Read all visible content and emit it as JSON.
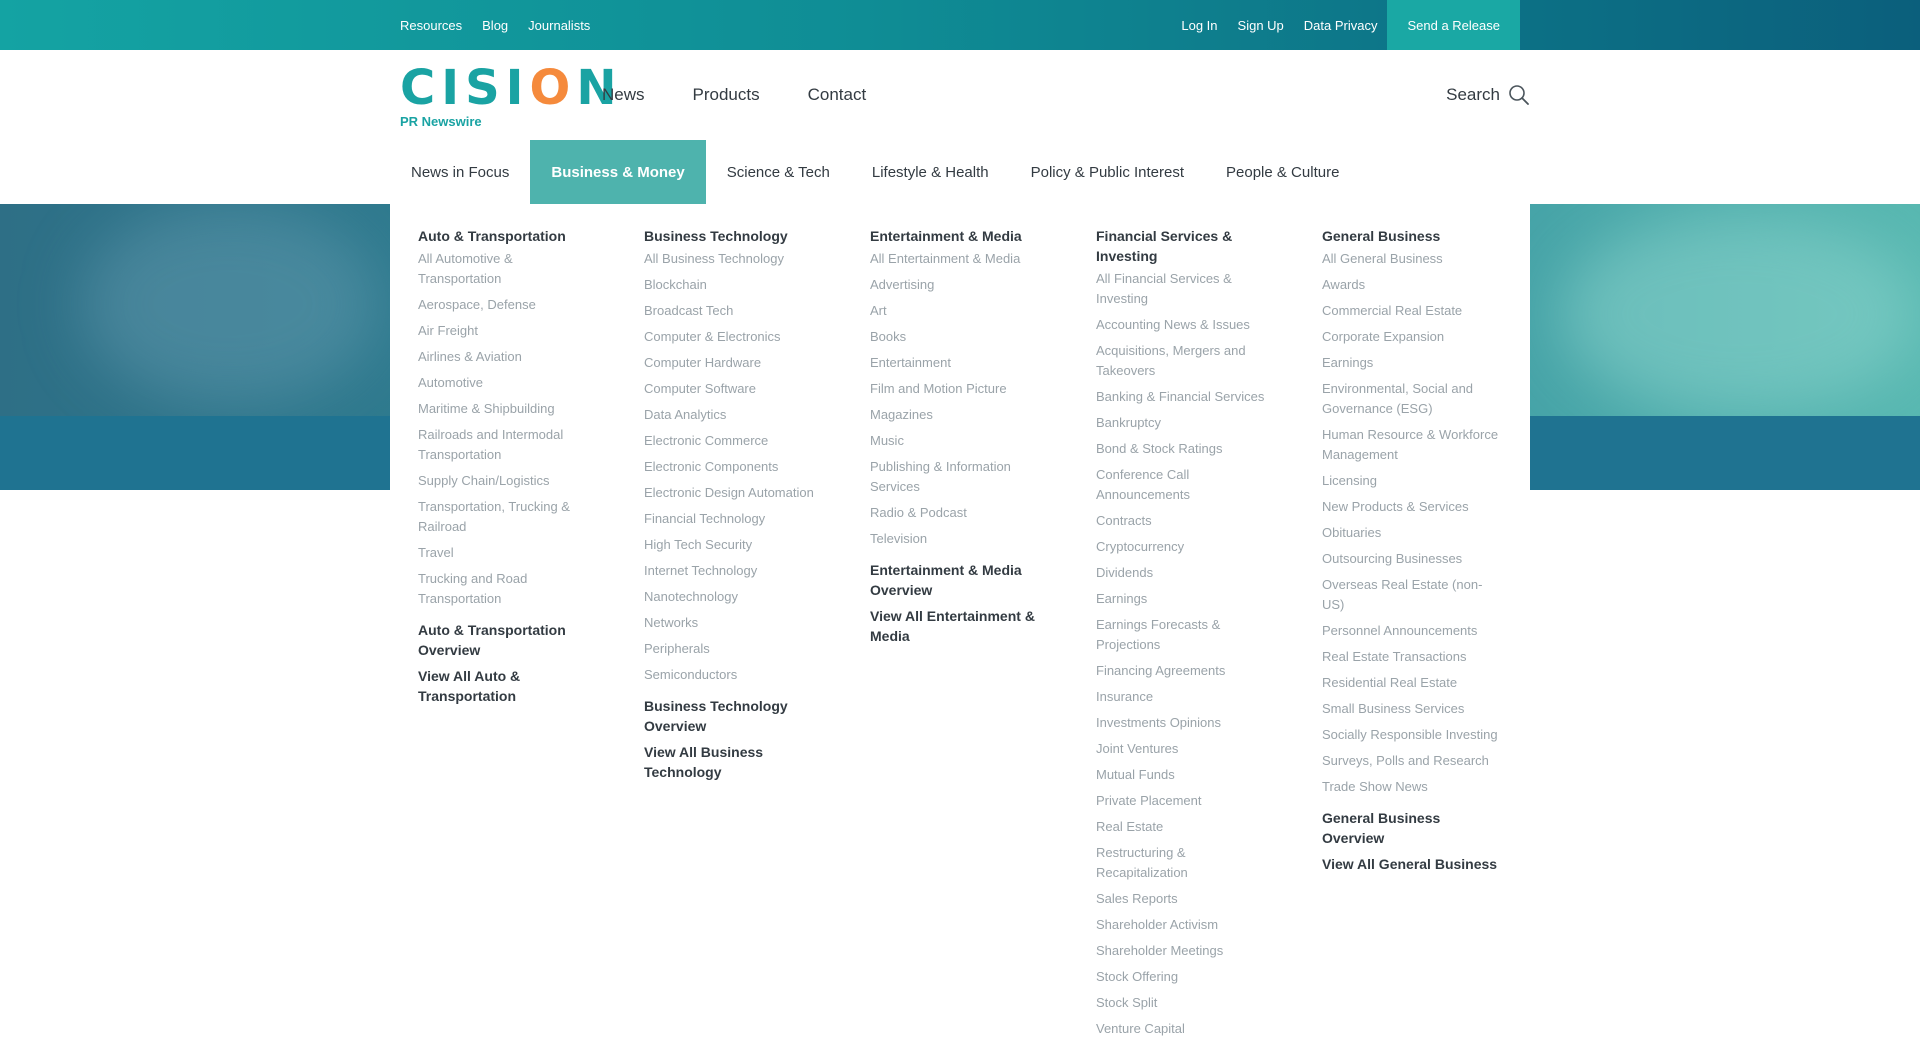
{
  "topbar": {
    "left_links": [
      "Resources",
      "Blog",
      "Journalists"
    ],
    "right_links": [
      "Log In",
      "Sign Up",
      "Data Privacy"
    ],
    "send_release": "Send a Release"
  },
  "brand": {
    "word_a": "CISI",
    "word_o": "O",
    "word_b": "N",
    "sub": "PR Newswire"
  },
  "mainnav": [
    "News",
    "Products",
    "Contact"
  ],
  "search": {
    "label": "Search",
    "icon": "search-icon"
  },
  "tabs": [
    {
      "label": "News in Focus",
      "active": false
    },
    {
      "label": "Business & Money",
      "active": true
    },
    {
      "label": "Science & Tech",
      "active": false
    },
    {
      "label": "Lifestyle & Health",
      "active": false
    },
    {
      "label": "Policy & Public Interest",
      "active": false
    },
    {
      "label": "People & Culture",
      "active": false
    }
  ],
  "columns": [
    {
      "heading": "Auto & Transportation",
      "items": [
        "All Automotive & Transportation",
        "Aerospace, Defense",
        "Air Freight",
        "Airlines & Aviation",
        "Automotive",
        "Maritime & Shipbuilding",
        "Railroads and Intermodal Transportation",
        "Supply Chain/Logistics",
        "Transportation, Trucking & Railroad",
        "Travel",
        "Trucking and Road Transportation"
      ],
      "footer": [
        "Auto & Transportation Overview",
        "View All Auto & Transportation"
      ]
    },
    {
      "heading": "Business Technology",
      "items": [
        "All Business Technology",
        "Blockchain",
        "Broadcast Tech",
        "Computer & Electronics",
        "Computer Hardware",
        "Computer Software",
        "Data Analytics",
        "Electronic Commerce",
        "Electronic Components",
        "Electronic Design Automation",
        "Financial Technology",
        "High Tech Security",
        "Internet Technology",
        "Nanotechnology",
        "Networks",
        "Peripherals",
        "Semiconductors"
      ],
      "footer": [
        "Business Technology Overview",
        "View All Business Technology"
      ]
    },
    {
      "heading": "Entertainment & Media",
      "items": [
        "All Entertainment & Media",
        "Advertising",
        "Art",
        "Books",
        "Entertainment",
        "Film and Motion Picture",
        "Magazines",
        "Music",
        "Publishing & Information Services",
        "Radio & Podcast",
        "Television"
      ],
      "footer": [
        "Entertainment & Media Overview",
        "View All Entertainment & Media"
      ]
    },
    {
      "heading": "Financial Services & Investing",
      "items": [
        "All Financial Services & Investing",
        "Accounting News & Issues",
        "Acquisitions, Mergers and Takeovers",
        "Banking & Financial Services",
        "Bankruptcy",
        "Bond & Stock Ratings",
        "Conference Call Announcements",
        "Contracts",
        "Cryptocurrency",
        "Dividends",
        "Earnings",
        "Earnings Forecasts & Projections",
        "Financing Agreements",
        "Insurance",
        "Investments Opinions",
        "Joint Ventures",
        "Mutual Funds",
        "Private Placement",
        "Real Estate",
        "Restructuring & Recapitalization",
        "Sales Reports",
        "Shareholder Activism",
        "Shareholder Meetings",
        "Stock Offering",
        "Stock Split",
        "Venture Capital"
      ],
      "footer": []
    },
    {
      "heading": "General Business",
      "items": [
        "All General Business",
        "Awards",
        "Commercial Real Estate",
        "Corporate Expansion",
        "Earnings",
        "Environmental, Social and Governance (ESG)",
        "Human Resource & Workforce Management",
        "Licensing",
        "New Products & Services",
        "Obituaries",
        "Outsourcing Businesses",
        "Overseas Real Estate (non-US)",
        "Personnel Announcements",
        "Real Estate Transactions",
        "Residential Real Estate",
        "Small Business Services",
        "Socially Responsible Investing",
        "Surveys, Polls and Research",
        "Trade Show News"
      ],
      "footer": [
        "General Business Overview",
        "View All General Business"
      ]
    }
  ]
}
